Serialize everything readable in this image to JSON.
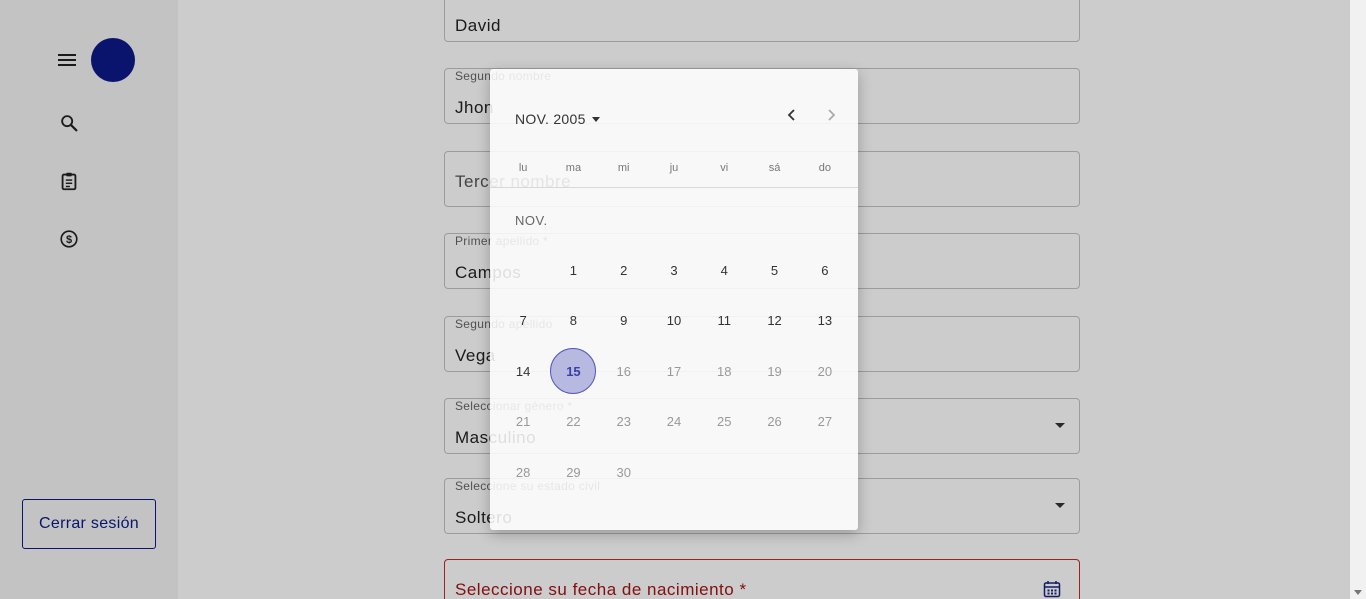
{
  "sidebar": {
    "icons": [
      "menu-icon",
      "search-icon",
      "clipboard-icon",
      "dollar-icon"
    ],
    "logout_label": "Cerrar sesión"
  },
  "form": {
    "first_name": {
      "value": "David"
    },
    "second_name": {
      "label": "Segundo nombre",
      "value": "Jhon"
    },
    "third_name": {
      "placeholder": "Tercer nombre"
    },
    "first_surname": {
      "label": "Primer apellido *",
      "value": "Campos"
    },
    "second_surname": {
      "label": "Segundo apellido",
      "value": "Vega"
    },
    "gender": {
      "label": "Seleccionar género *",
      "value": "Masculino"
    },
    "civil_status": {
      "label": "Seleccione su estado civil",
      "value": "Soltero"
    },
    "birth_date": {
      "placeholder": "Seleccione su fecha de nacimiento *"
    }
  },
  "datepicker": {
    "period_label": "NOV. 2005",
    "month_label": "NOV.",
    "weekdays": [
      "lu",
      "ma",
      "mi",
      "ju",
      "vi",
      "sá",
      "do"
    ],
    "weeks": [
      [
        "",
        "1",
        "2",
        "3",
        "4",
        "5",
        "6"
      ],
      [
        "7",
        "8",
        "9",
        "10",
        "11",
        "12",
        "13"
      ],
      [
        "14",
        "15",
        "16",
        "17",
        "18",
        "19",
        "20"
      ],
      [
        "21",
        "22",
        "23",
        "24",
        "25",
        "26",
        "27"
      ],
      [
        "28",
        "29",
        "30",
        "",
        "",
        "",
        ""
      ]
    ],
    "selected_day": "15",
    "enabled_through_day": 15
  },
  "colors": {
    "brand": "#0d1a87",
    "selected_fill": "#b7b9e0",
    "error": "#c62828"
  }
}
